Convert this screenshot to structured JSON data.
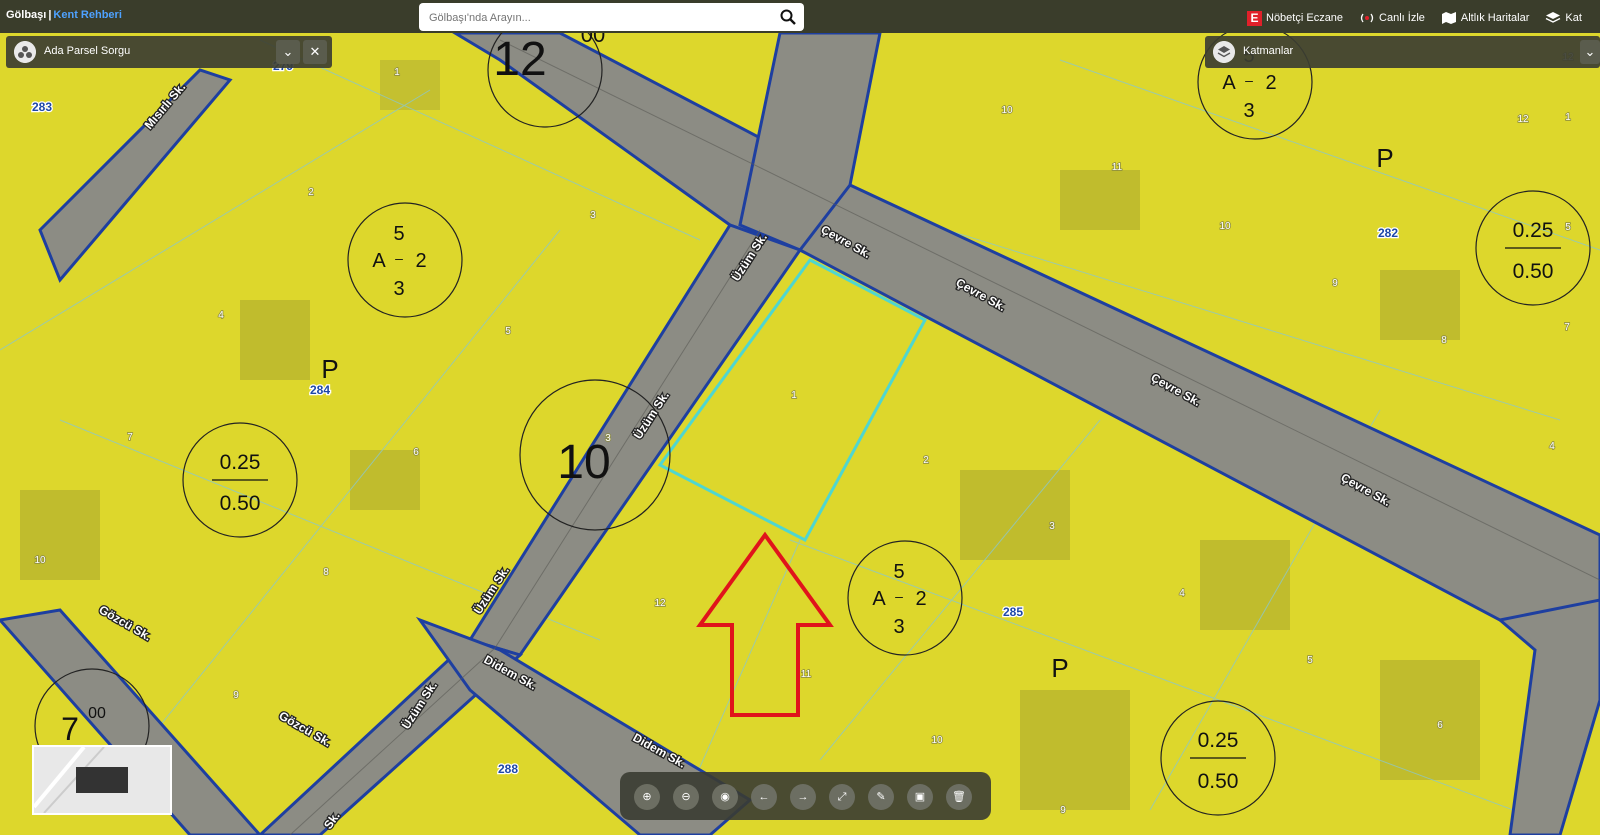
{
  "brand": {
    "name": "Gölbaşı",
    "separator": "|",
    "subtitle": "Kent Rehberi"
  },
  "search": {
    "placeholder": "Gölbaşı'nda Arayın...",
    "icon": "search-icon"
  },
  "top_links": [
    {
      "label": "Nöbetçi Eczane",
      "icon": "pharmacy-e-icon",
      "icon_text": "E"
    },
    {
      "label": "Canlı İzle",
      "icon": "live-broadcast-icon"
    },
    {
      "label": "Altlık Haritalar",
      "icon": "base-map-icon"
    },
    {
      "label": "Kat",
      "icon": "layers-icon"
    }
  ],
  "left_panel": {
    "title": "Ada Parsel Sorgu",
    "icon": "parcel-query-icon"
  },
  "right_panel": {
    "title": "Katmanlar",
    "icon": "layers-icon"
  },
  "toolbar": [
    {
      "name": "zoom-in",
      "glyph": "⊕"
    },
    {
      "name": "zoom-out",
      "glyph": "⊖"
    },
    {
      "name": "locate",
      "glyph": "◉"
    },
    {
      "name": "back",
      "glyph": "←"
    },
    {
      "name": "forward",
      "glyph": "→"
    },
    {
      "name": "full-extent",
      "glyph": "⤢"
    },
    {
      "name": "measure",
      "glyph": "✎"
    },
    {
      "name": "edit",
      "glyph": "▣"
    },
    {
      "name": "clear",
      "glyph": "🗑"
    }
  ],
  "map": {
    "colors": {
      "zone": "#e2dc2a",
      "road": "#8c8c84",
      "parcel_border": "#1e3fa0",
      "highlight": "#4fd6d0",
      "arrow": "#e0141b"
    },
    "streets": [
      "Çevre Sk.",
      "Çevre Sk.",
      "Çevre Sk.",
      "Çevre Sk.",
      "Üzüm Sk.",
      "Üzüm Sk.",
      "Üzüm Sk.",
      "Üzüm Sk.",
      "Didem Sk.",
      "Didem Sk.",
      "Mısırlı Sk.",
      "Gözcü Sk.",
      "Gözcü Sk.",
      "Sk."
    ],
    "block_numbers": [
      "283",
      "279",
      "284",
      "282",
      "285",
      "288"
    ],
    "parcel_numbers": [
      "1",
      "2",
      "3",
      "4",
      "5",
      "6",
      "7",
      "8",
      "9",
      "10",
      "10",
      "12",
      "11",
      "10",
      "9",
      "8",
      "4",
      "7",
      "6",
      "5",
      "9",
      "3",
      "2",
      "1",
      "4",
      "12",
      "11",
      "10",
      "3",
      "5",
      "1",
      "12"
    ],
    "zone_letters": [
      "P",
      "P",
      "P"
    ],
    "sheet_numbers": [
      "12",
      "00",
      "10",
      "7",
      "00"
    ],
    "far_circles": [
      {
        "top": "A",
        "upper": "5",
        "mid": "2",
        "lower": "3"
      },
      {
        "top": "A",
        "upper": "5",
        "mid": "2",
        "lower": "3"
      },
      {
        "top": "A",
        "upper": "5",
        "mid": "2",
        "lower": "3"
      }
    ],
    "ratio_circles": [
      {
        "num": "0.25",
        "den": "0.50"
      },
      {
        "num": "0.25",
        "den": "0.50"
      },
      {
        "num": "0.25",
        "den": "0.50"
      }
    ]
  }
}
